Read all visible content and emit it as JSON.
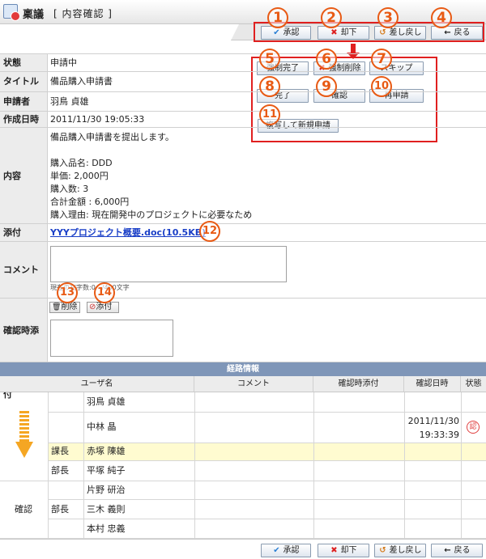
{
  "header": {
    "title": "稟議",
    "subtitle": "[ 内容確認 ]"
  },
  "toolbar": {
    "approve": "承認",
    "reject": "却下",
    "sendback": "差し戻し",
    "back": "戻る",
    "force_complete": "強制完了",
    "force_delete": "強制削除",
    "skip": "スキップ",
    "complete": "完了",
    "confirm": "確認",
    "reapply": "再申請",
    "new_from_copy": "複写して新規申請"
  },
  "annotations": [
    "1",
    "2",
    "3",
    "4",
    "5",
    "6",
    "7",
    "8",
    "9",
    "10",
    "11",
    "12",
    "13",
    "14"
  ],
  "form": {
    "status_label": "状態",
    "status": "申請中",
    "title_label": "タイトル",
    "title": "備品購入申請書",
    "applicant_label": "申請者",
    "applicant": "羽鳥 貞雄",
    "created_label": "作成日時",
    "created": "2011/11/30 19:05:33",
    "content_label": "内容",
    "content_lines": [
      "備品購入申請書を提出します。",
      "",
      "購入品名: DDD",
      "単価: 2,000円",
      "購入数: 3",
      "合計金額 : 6,000円",
      "購入理由: 現在開発中のプロジェクトに必要なため"
    ],
    "attachment_label": "添付",
    "attachment": "YYYプロジェクト概要.doc(10.5KB)",
    "comment_label": "コメント",
    "comment_value": "",
    "char_count": "現在の文字数:0　/400文字",
    "confirm_attach_label": "確認時添付",
    "delete_button": "削除",
    "attach_button": "添付"
  },
  "route": {
    "section_title": "経路情報",
    "headers": {
      "user": "ユーザ名",
      "comment": "コメント",
      "confirm_attach": "確認時添付",
      "confirm_date": "確認日時",
      "status": "状態"
    },
    "rows": [
      {
        "group": "",
        "role": "",
        "name": "羽鳥 貞雄",
        "date": "",
        "status": ""
      },
      {
        "group": "",
        "role": "",
        "name": "中林 晶",
        "date": "2011/11/30 19:33:39",
        "status": "認"
      },
      {
        "group": "",
        "role": "課長",
        "name": "赤塚 陳雄",
        "date": "",
        "status": ""
      },
      {
        "group": "",
        "role": "部長",
        "name": "平塚 純子",
        "date": "",
        "status": ""
      },
      {
        "group": "確認",
        "role": "",
        "name": "片野 研治",
        "date": "",
        "status": ""
      },
      {
        "group": "確認",
        "role": "部長",
        "name": "三木 義則",
        "date": "",
        "status": ""
      },
      {
        "group": "確認",
        "role": "",
        "name": "本村 忠義",
        "date": "",
        "status": ""
      }
    ]
  },
  "colors": {
    "accent": "#e85a14",
    "highlight_row": "#fffbd0",
    "section_bg": "#7f96b8",
    "arrow": "#f5a623"
  }
}
